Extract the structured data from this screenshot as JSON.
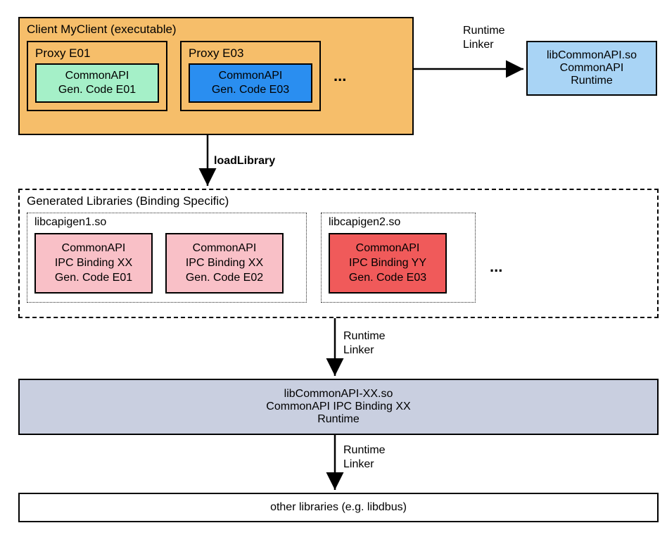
{
  "client": {
    "title": "Client MyClient (executable)",
    "proxies": [
      {
        "title": "Proxy E01",
        "code_l1": "CommonAPI",
        "code_l2": "Gen. Code E01"
      },
      {
        "title": "Proxy E03",
        "code_l1": "CommonAPI",
        "code_l2": "Gen. Code E03"
      }
    ],
    "ellipsis": "..."
  },
  "arrows": {
    "runtime_linker_1": "Runtime\nLinker",
    "load_library": "loadLibrary",
    "runtime_linker_2": "Runtime\nLinker",
    "runtime_linker_3": "Runtime\nLinker"
  },
  "lib_commonapi": {
    "l1": "libCommonAPI.so",
    "l2": "CommonAPI",
    "l3": "Runtime"
  },
  "generated_libs": {
    "title": "Generated Libraries (Binding Specific)",
    "ellipsis": "...",
    "lib1": {
      "title": "libcapigen1.so",
      "bindings": [
        {
          "l1": "CommonAPI",
          "l2": "IPC Binding XX",
          "l3": "Gen. Code E01"
        },
        {
          "l1": "CommonAPI",
          "l2": "IPC Binding XX",
          "l3": "Gen. Code E02"
        }
      ]
    },
    "lib2": {
      "title": "libcapigen2.so",
      "bindings": [
        {
          "l1": "CommonAPI",
          "l2": "IPC Binding YY",
          "l3": "Gen. Code E03"
        }
      ]
    }
  },
  "ipc_runtime": {
    "l1": "libCommonAPI-XX.so",
    "l2": "CommonAPI IPC Binding XX",
    "l3": "Runtime"
  },
  "other_libs": {
    "label": "other libraries (e.g. libdbus)"
  }
}
